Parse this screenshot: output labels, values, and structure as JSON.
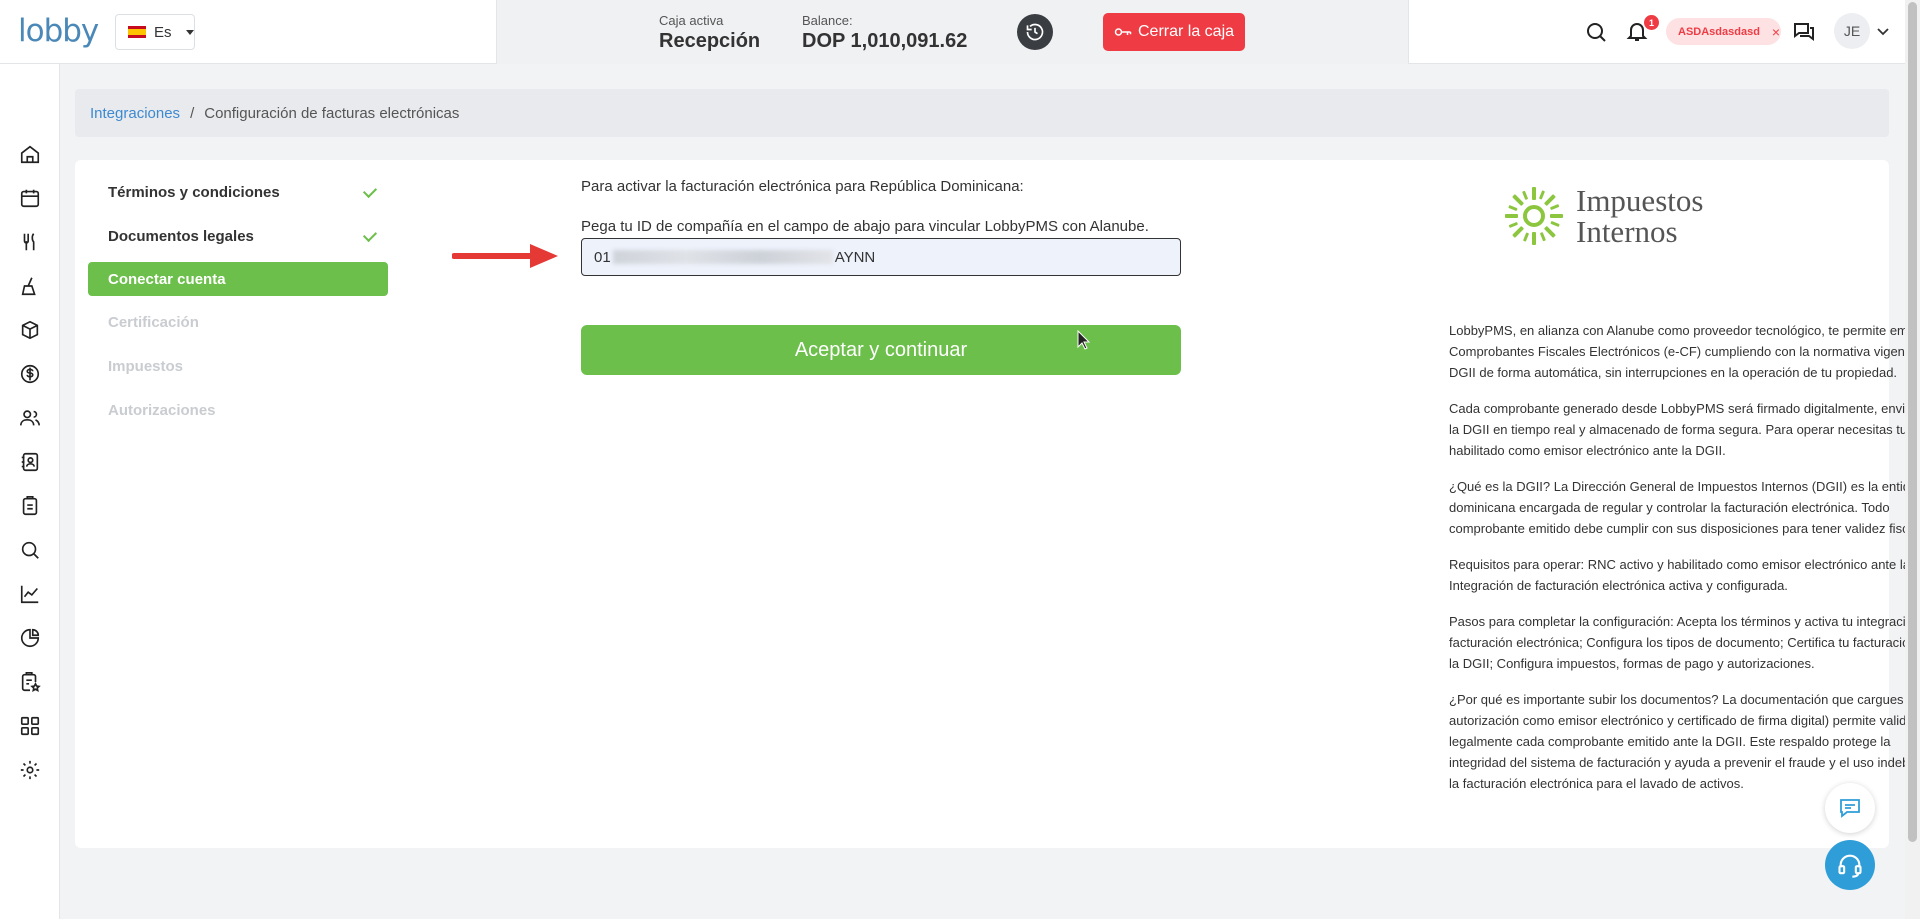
{
  "header": {
    "logo": "lobby",
    "language": "Es",
    "cash": {
      "active_label": "Caja activa",
      "active_value": "Recepción",
      "balance_label": "Balance:",
      "balance_value": "DOP 1,010,091.62",
      "close_button": "Cerrar la caja"
    },
    "notifications_count": "1",
    "user_tag": "ASDAsdasdasd",
    "user_tag_close": "×",
    "avatar_initials": "JE"
  },
  "breadcrumb": {
    "parent": "Integraciones",
    "separator": "/",
    "current": "Configuración de facturas electrónicas"
  },
  "steps": [
    {
      "label": "Términos y condiciones",
      "state": "done"
    },
    {
      "label": "Documentos legales",
      "state": "done"
    },
    {
      "label": "Conectar cuenta",
      "state": "active"
    },
    {
      "label": "Certificación",
      "state": "pending"
    },
    {
      "label": "Impuestos",
      "state": "pending"
    },
    {
      "label": "Autorizaciones",
      "state": "pending"
    }
  ],
  "form": {
    "intro": "Para activar la facturación electrónica para República Dominicana:",
    "hint": "Pega tu ID de compañía en el campo de abajo para vincular LobbyPMS con Alanube.",
    "id_prefix": "01",
    "id_suffix": "AYNN",
    "accept_button": "Aceptar y continuar"
  },
  "brand": {
    "line1": "Impuestos",
    "line2": "Internos"
  },
  "info_paragraphs": [
    "LobbyPMS, en alianza con Alanube como proveedor tecnológico, te permite emitir tus Comprobantes Fiscales Electrónicos (e-CF) cumpliendo con la normativa vigente de la DGII de forma automática, sin interrupciones en la operación de tu propiedad.",
    "Cada comprobante generado desde LobbyPMS será firmado digitalmente, enviado a la DGII en tiempo real y almacenado de forma segura. Para operar necesitas tu RNC habilitado como emisor electrónico ante la DGII.",
    "¿Qué es la DGII? La Dirección General de Impuestos Internos (DGII) es la entidad dominicana encargada de regular y controlar la facturación electrónica. Todo comprobante emitido debe cumplir con sus disposiciones para tener validez fiscal.",
    "Requisitos para operar: RNC activo y habilitado como emisor electrónico ante la DGII, Integración de facturación electrónica activa y configurada.",
    "Pasos para completar la configuración: Acepta los términos y activa tu integración de facturación electrónica; Configura los tipos de documento; Certifica tu facturación ante la DGII; Configura impuestos, formas de pago y autorizaciones.",
    "¿Por qué es importante subir los documentos? La documentación que cargues (RNC, autorización como emisor electrónico y certificado de firma digital) permite validar legalmente cada comprobante emitido ante la DGII. Este respaldo protege la integridad del sistema de facturación y ayuda a prevenir el fraude y el uso indebido de la facturación electrónica para el lavado de activos."
  ],
  "colors": {
    "accent_green": "#6cbf4a",
    "danger_red": "#ef3c44",
    "link_blue": "#3d8ad1"
  }
}
